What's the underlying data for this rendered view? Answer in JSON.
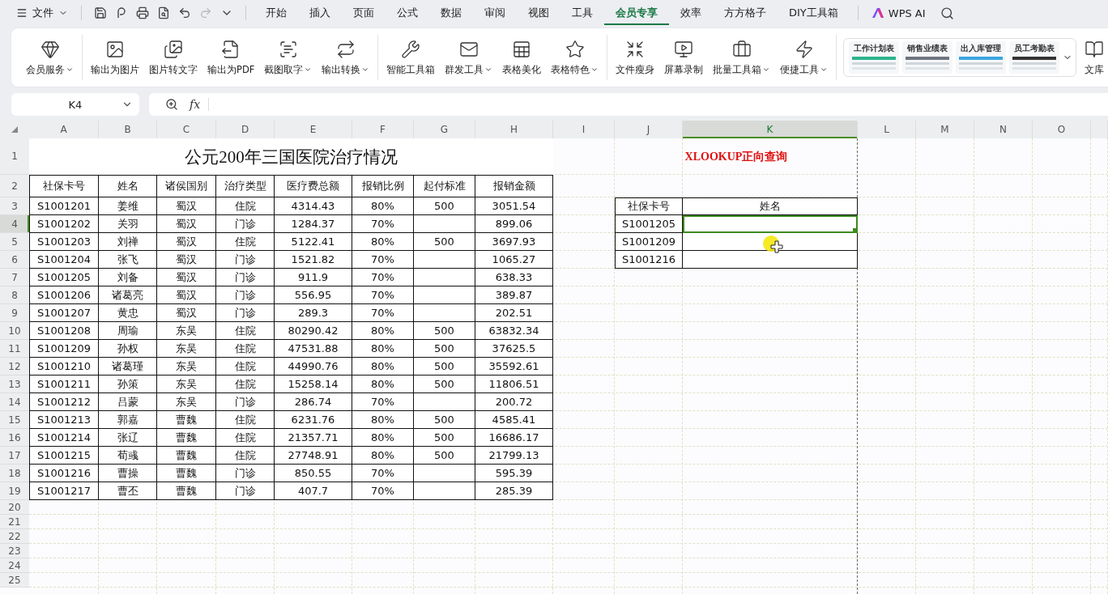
{
  "menu_bar": {
    "file_menu": "文件",
    "tabs": [
      {
        "label": "开始",
        "selected": false
      },
      {
        "label": "插入",
        "selected": false
      },
      {
        "label": "页面",
        "selected": false
      },
      {
        "label": "公式",
        "selected": false
      },
      {
        "label": "数据",
        "selected": false
      },
      {
        "label": "审阅",
        "selected": false
      },
      {
        "label": "视图",
        "selected": false
      },
      {
        "label": "工具",
        "selected": false
      },
      {
        "label": "会员专享",
        "selected": true
      },
      {
        "label": "效率",
        "selected": false
      },
      {
        "label": "方方格子",
        "selected": false
      },
      {
        "label": "DIY工具箱",
        "selected": false
      }
    ],
    "ai_button": "WPS AI"
  },
  "ribbon": {
    "groups": [
      {
        "items": [
          {
            "label": "会员服务",
            "dropdown": true
          }
        ]
      },
      {
        "items": [
          {
            "label": "输出为图片",
            "dropdown": false
          },
          {
            "label": "图片转文字",
            "dropdown": false
          },
          {
            "label": "输出为PDF",
            "dropdown": false
          },
          {
            "label": "截图取字",
            "dropdown": true
          },
          {
            "label": "输出转换",
            "dropdown": true
          }
        ]
      },
      {
        "items": [
          {
            "label": "智能工具箱",
            "dropdown": false
          },
          {
            "label": "群发工具",
            "dropdown": true
          },
          {
            "label": "表格美化",
            "dropdown": false
          },
          {
            "label": "表格特色",
            "dropdown": true
          }
        ]
      },
      {
        "items": [
          {
            "label": "文件瘦身",
            "dropdown": false
          },
          {
            "label": "屏幕录制",
            "dropdown": false
          },
          {
            "label": "批量工具箱",
            "dropdown": true
          },
          {
            "label": "便捷工具",
            "dropdown": true
          }
        ]
      }
    ],
    "templates": [
      "工作计划表",
      "销售业绩表",
      "出入库管理",
      "员工考勤表"
    ],
    "library": "文库"
  },
  "formula_bar": {
    "name_box": "K4",
    "fx_label": "fx"
  },
  "sheet": {
    "columns": [
      {
        "label": "A",
        "selected": false
      },
      {
        "label": "B",
        "selected": false
      },
      {
        "label": "C",
        "selected": false
      },
      {
        "label": "D",
        "selected": false
      },
      {
        "label": "E",
        "selected": false
      },
      {
        "label": "F",
        "selected": false
      },
      {
        "label": "G",
        "selected": false
      },
      {
        "label": "H",
        "selected": false
      },
      {
        "label": "I",
        "selected": false
      },
      {
        "label": "J",
        "selected": false
      },
      {
        "label": "K",
        "selected": true
      },
      {
        "label": "L",
        "selected": false
      },
      {
        "label": "M",
        "selected": false
      },
      {
        "label": "N",
        "selected": false
      },
      {
        "label": "O",
        "selected": false
      }
    ],
    "rows": [
      {
        "label": "1",
        "selected": false
      },
      {
        "label": "2",
        "selected": false
      },
      {
        "label": "3",
        "selected": false
      },
      {
        "label": "4",
        "selected": true
      },
      {
        "label": "5",
        "selected": false
      },
      {
        "label": "6",
        "selected": false
      },
      {
        "label": "7",
        "selected": false
      },
      {
        "label": "8",
        "selected": false
      },
      {
        "label": "9",
        "selected": false
      },
      {
        "label": "10",
        "selected": false
      },
      {
        "label": "11",
        "selected": false
      },
      {
        "label": "12",
        "selected": false
      },
      {
        "label": "13",
        "selected": false
      },
      {
        "label": "14",
        "selected": false
      },
      {
        "label": "15",
        "selected": false
      },
      {
        "label": "16",
        "selected": false
      },
      {
        "label": "17",
        "selected": false
      },
      {
        "label": "18",
        "selected": false
      },
      {
        "label": "19",
        "selected": false
      },
      {
        "label": "20",
        "selected": false
      },
      {
        "label": "21",
        "selected": false
      },
      {
        "label": "22",
        "selected": false
      },
      {
        "label": "23",
        "selected": false
      },
      {
        "label": "24",
        "selected": false
      },
      {
        "label": "25",
        "selected": false
      }
    ],
    "title": "公元200年三国医院治疗情况",
    "headers": [
      "社保卡号",
      "姓名",
      "诸侯国别",
      "治疗类型",
      "医疗费总额",
      "报销比例",
      "起付标准",
      "报销金额"
    ],
    "records": [
      {
        "id": "S1001201",
        "name": "姜维",
        "state": "蜀汉",
        "type": "住院",
        "cost": "4314.43",
        "ratio": "80%",
        "threshold": "500",
        "amount": "3051.54"
      },
      {
        "id": "S1001202",
        "name": "关羽",
        "state": "蜀汉",
        "type": "门诊",
        "cost": "1284.37",
        "ratio": "70%",
        "amount": "899.06"
      },
      {
        "id": "S1001203",
        "name": "刘禅",
        "state": "蜀汉",
        "type": "住院",
        "cost": "5122.41",
        "ratio": "80%",
        "threshold": "500",
        "amount": "3697.93"
      },
      {
        "id": "S1001204",
        "name": "张飞",
        "state": "蜀汉",
        "type": "门诊",
        "cost": "1521.82",
        "ratio": "70%",
        "amount": "1065.27"
      },
      {
        "id": "S1001205",
        "name": "刘备",
        "state": "蜀汉",
        "type": "门诊",
        "cost": "911.9",
        "ratio": "70%",
        "amount": "638.33"
      },
      {
        "id": "S1001206",
        "name": "诸葛亮",
        "state": "蜀汉",
        "type": "门诊",
        "cost": "556.95",
        "ratio": "70%",
        "amount": "389.87"
      },
      {
        "id": "S1001207",
        "name": "黄忠",
        "state": "蜀汉",
        "type": "门诊",
        "cost": "289.3",
        "ratio": "70%",
        "amount": "202.51"
      },
      {
        "id": "S1001208",
        "name": "周瑜",
        "state": "东吴",
        "type": "住院",
        "cost": "80290.42",
        "ratio": "80%",
        "threshold": "500",
        "amount": "63832.34"
      },
      {
        "id": "S1001209",
        "name": "孙权",
        "state": "东吴",
        "type": "住院",
        "cost": "47531.88",
        "ratio": "80%",
        "threshold": "500",
        "amount": "37625.5"
      },
      {
        "id": "S1001210",
        "name": "诸葛瑾",
        "state": "东吴",
        "type": "住院",
        "cost": "44990.76",
        "ratio": "80%",
        "threshold": "500",
        "amount": "35592.61"
      },
      {
        "id": "S1001211",
        "name": "孙策",
        "state": "东吴",
        "type": "住院",
        "cost": "15258.14",
        "ratio": "80%",
        "threshold": "500",
        "amount": "11806.51"
      },
      {
        "id": "S1001212",
        "name": "吕蒙",
        "state": "东吴",
        "type": "门诊",
        "cost": "286.74",
        "ratio": "70%",
        "amount": "200.72"
      },
      {
        "id": "S1001213",
        "name": "郭嘉",
        "state": "曹魏",
        "type": "住院",
        "cost": "6231.76",
        "ratio": "80%",
        "threshold": "500",
        "amount": "4585.41"
      },
      {
        "id": "S1001214",
        "name": "张辽",
        "state": "曹魏",
        "type": "住院",
        "cost": "21357.71",
        "ratio": "80%",
        "threshold": "500",
        "amount": "16686.17"
      },
      {
        "id": "S1001215",
        "name": "荀彧",
        "state": "曹魏",
        "type": "住院",
        "cost": "27748.91",
        "ratio": "80%",
        "threshold": "500",
        "amount": "21799.13"
      },
      {
        "id": "S1001216",
        "name": "曹操",
        "state": "曹魏",
        "type": "门诊",
        "cost": "850.55",
        "ratio": "70%",
        "amount": "595.39"
      },
      {
        "id": "S1001217",
        "name": "曹丕",
        "state": "曹魏",
        "type": "门诊",
        "cost": "407.7",
        "ratio": "70%",
        "amount": "285.39"
      }
    ],
    "lookup": {
      "title": "XLOOKUP正向查询",
      "headers": [
        "社保卡号",
        "姓名"
      ],
      "rows": [
        {
          "id": "S1001205",
          "selected": true
        },
        {
          "id": "S1001209",
          "selected": false
        },
        {
          "id": "S1001216",
          "selected": false
        }
      ]
    }
  }
}
